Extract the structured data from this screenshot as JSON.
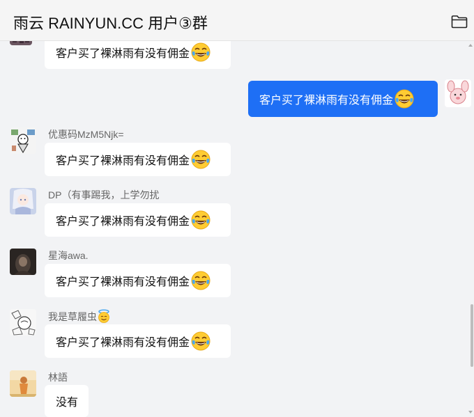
{
  "header": {
    "title": "雨云 RAINYUN.CC 用户③群",
    "folder_icon": "folder-icon"
  },
  "colors": {
    "self_bubble": "#1e6ff5",
    "other_bubble": "#ffffff",
    "background": "#f2f3f5"
  },
  "messages": [
    {
      "sender": "",
      "text": "客户买了裸淋雨有没有佣金",
      "emoji": "face-with-tears-of-joy",
      "self": false
    },
    {
      "sender": "",
      "text": "客户买了裸淋雨有没有佣金",
      "emoji": "face-with-tears-of-joy",
      "self": true
    },
    {
      "sender": "优惠码MzM5Njk=",
      "text": "客户买了裸淋雨有没有佣金",
      "emoji": "face-with-tears-of-joy",
      "self": false
    },
    {
      "sender": "DP（有事踢我，上学勿扰",
      "text": "客户买了裸淋雨有没有佣金",
      "emoji": "face-with-tears-of-joy",
      "self": false
    },
    {
      "sender": "星海awa.",
      "text": "客户买了裸淋雨有没有佣金",
      "emoji": "face-with-tears-of-joy",
      "self": false
    },
    {
      "sender": "我是草履虫",
      "sender_emoji": "smiling-face-with-halo",
      "text": "客户买了裸淋雨有没有佣金",
      "emoji": "face-with-tears-of-joy",
      "self": false
    },
    {
      "sender": "林語",
      "text": "没有",
      "self": false
    }
  ]
}
